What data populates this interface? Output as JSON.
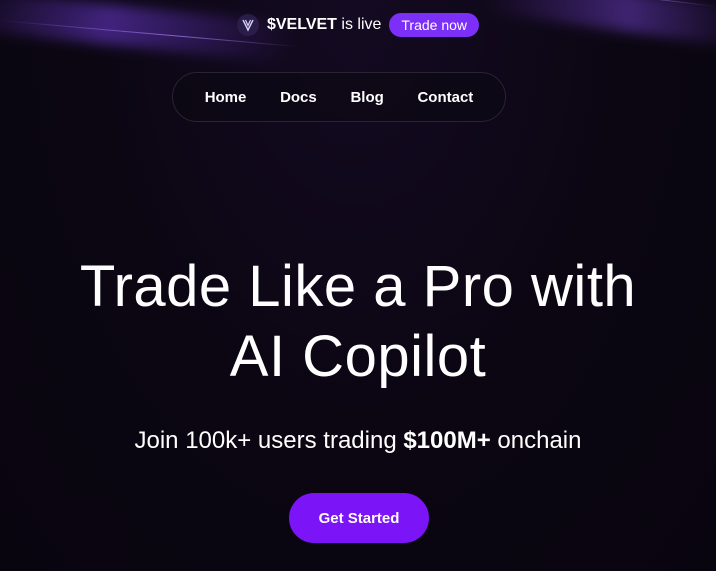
{
  "announcement": {
    "token": "$VELVET",
    "suffix": " is live",
    "button_label": "Trade now",
    "logo_icon": "velvet-logo-icon"
  },
  "nav": {
    "items": [
      {
        "label": "Home"
      },
      {
        "label": "Docs"
      },
      {
        "label": "Blog"
      },
      {
        "label": "Contact"
      }
    ]
  },
  "hero": {
    "title_line1": "Trade Like a Pro with",
    "title_line2": "AI Copilot",
    "subtitle_prefix": "Join 100k+ users trading ",
    "subtitle_highlight": "$100M+",
    "subtitle_suffix": " onchain",
    "cta_label": "Get Started"
  },
  "colors": {
    "background": "#0b0612",
    "accent": "#7b14f6",
    "nav_border": "#2a2333"
  }
}
